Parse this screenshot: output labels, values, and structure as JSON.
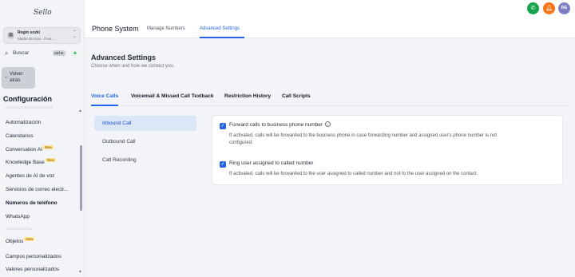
{
  "sidebar": {
    "logo_text": "Sello",
    "account": {
      "name": "Rogin sozki",
      "subtitle": "Madre de Dios - Puer..."
    },
    "search": {
      "placeholder": "Buscar",
      "shortcut": "ctrl K"
    },
    "back_label": "Volver atrás",
    "config_title": "Configuración",
    "section_top": "SERVICIOS PERSONALIZADOS",
    "items": [
      {
        "label": "Automatización"
      },
      {
        "label": "Calendarios"
      },
      {
        "label": "Conversation AI",
        "badge": "New"
      },
      {
        "label": "Knowledge Base",
        "badge": "New"
      },
      {
        "label": "Agentes de AI de voz"
      },
      {
        "label": "Servicios de correo electr..."
      },
      {
        "label": "Números de teléfono",
        "active": true
      },
      {
        "label": "WhatsApp"
      }
    ],
    "section_2": "OTROS AJUSTES",
    "items_2": [
      {
        "label": "Objetos",
        "badge": "New"
      },
      {
        "label": "Campos personalizados"
      },
      {
        "label": "Valores personalizados"
      }
    ]
  },
  "header": {
    "avatar_initials": "RE"
  },
  "subheader": {
    "title": "Phone System",
    "tabs": [
      {
        "label": "Manage Numbers"
      },
      {
        "label": "Advanced Settings",
        "active": true
      }
    ]
  },
  "main": {
    "title": "Advanced Settings",
    "subtitle": "Choose when and how we contact you.",
    "tabs": [
      {
        "label": "Voice Calls",
        "active": true
      },
      {
        "label": "Voicemail & Missed Call Textback"
      },
      {
        "label": "Restriction History"
      },
      {
        "label": "Call Scripts"
      }
    ],
    "side_nav": [
      {
        "label": "Inbound Call",
        "active": true
      },
      {
        "label": "Outbound Call"
      },
      {
        "label": "Call Recording"
      }
    ],
    "options": [
      {
        "title": "Forward calls to business phone number",
        "checked": true,
        "description_1": "If activated, calls will be forwarded to the business phone in case forwarding number and assigned user's phone number is not",
        "description_2": "configured."
      },
      {
        "title": "Ring user assigned to called number",
        "checked": true,
        "description_1": "If activated, calls will be forwarded to the user assigned to called number and not to the user assigned on the contact."
      }
    ]
  },
  "colors": {
    "accent": "#2563eb",
    "phone_green": "#16a34a",
    "bell_orange": "#f97316",
    "avatar": "#7c7fc4"
  }
}
